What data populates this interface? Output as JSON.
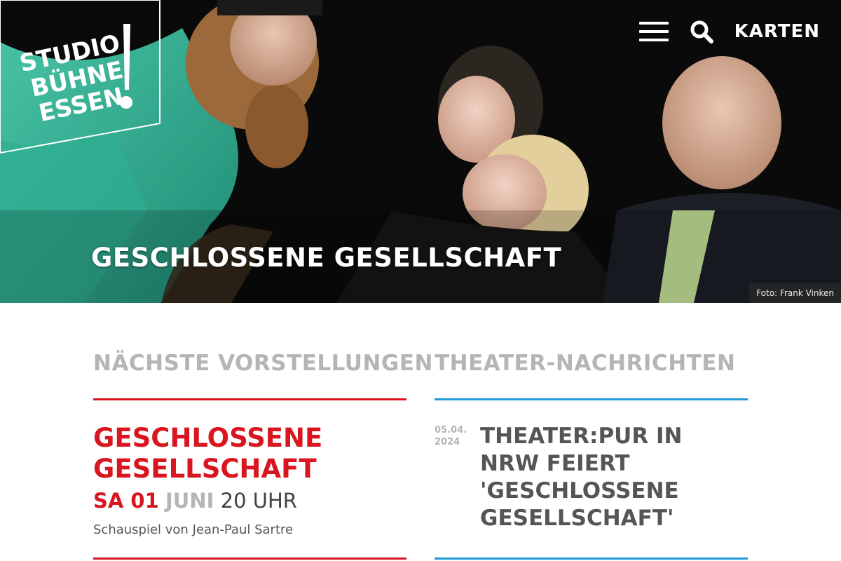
{
  "brand": {
    "logo_lines": [
      "STUDIO",
      "BÜHNE",
      "ESSEN"
    ],
    "logo_mark": "!"
  },
  "header": {
    "menu_icon": "hamburger-menu-icon",
    "search_icon": "search-icon",
    "tickets_label": "KARTEN"
  },
  "hero": {
    "title": "GESCHLOSSENE GESELLSCHAFT",
    "photo_credit": "Foto: Frank Vinken"
  },
  "performances": {
    "heading": "NÄCHSTE VORSTELLUNGEN",
    "items": [
      {
        "title": "GESCHLOSSENE GESELLSCHAFT",
        "weekday_day": "SA 01",
        "month": "JUNI",
        "time": "20 UHR",
        "subtitle": "Schauspiel von Jean-Paul Sartre"
      }
    ]
  },
  "news": {
    "heading": "THEATER-NACHRICHTEN",
    "items": [
      {
        "date_line1": "05.04.",
        "date_line2": "2024",
        "title": "THEATER:PUR IN NRW FEIERT 'GESCHLOSSENE GESELLSCHAFT'"
      }
    ]
  },
  "colors": {
    "accent_red": "#d9161f",
    "accent_blue": "#1f9ad6",
    "muted_gray": "#b5b5b5",
    "logo_teal": "#2aa58a"
  }
}
